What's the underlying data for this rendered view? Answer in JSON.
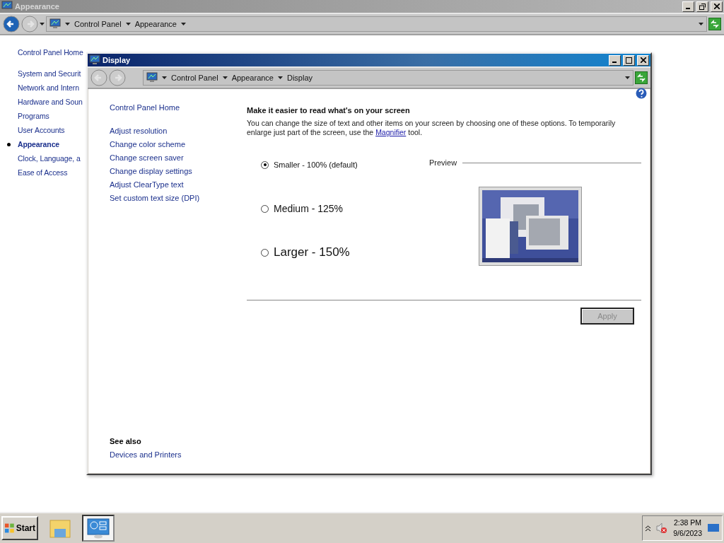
{
  "background_window": {
    "title": "Appearance",
    "breadcrumb": [
      "Control Panel",
      "Appearance"
    ],
    "nav": [
      {
        "label": "Control Panel Home",
        "selected": false
      },
      {
        "label": "System and Securit",
        "selected": false
      },
      {
        "label": "Network and Intern",
        "selected": false
      },
      {
        "label": "Hardware and Soun",
        "selected": false
      },
      {
        "label": "Programs",
        "selected": false
      },
      {
        "label": "User Accounts",
        "selected": false
      },
      {
        "label": "Appearance",
        "selected": true
      },
      {
        "label": "Clock, Language, a",
        "selected": false
      },
      {
        "label": "Ease of Access",
        "selected": false
      }
    ]
  },
  "display_window": {
    "title": "Display",
    "breadcrumb": [
      "Control Panel",
      "Appearance",
      "Display"
    ],
    "home_link": "Control Panel Home",
    "tasks": [
      "Adjust resolution",
      "Change color scheme",
      "Change screen saver",
      "Change display settings",
      "Adjust ClearType text",
      "Set custom text size (DPI)"
    ],
    "heading": "Make it easier to read what's on your screen",
    "description": "You can change the size of text and other items on your screen by choosing one of these options. To temporarily enlarge just part of the screen, use the",
    "link": "Magnifier",
    "description_end": "tool.",
    "options": [
      {
        "label": "Smaller - 100% (default)",
        "selected": true
      },
      {
        "label": "Medium - 125%",
        "selected": false
      },
      {
        "label": "Larger - 150%",
        "selected": false
      }
    ],
    "preview_label": "Preview",
    "apply": {
      "label": "Apply",
      "disabled": true
    },
    "see_also": {
      "heading": "See also",
      "links": [
        "Devices and Printers"
      ]
    }
  },
  "taskbar": {
    "start": "Start",
    "items": [
      {
        "kind": "folder",
        "selected": false
      },
      {
        "kind": "display",
        "selected": true
      }
    ],
    "time": "2:38 PM",
    "date": "9/6/2023"
  }
}
